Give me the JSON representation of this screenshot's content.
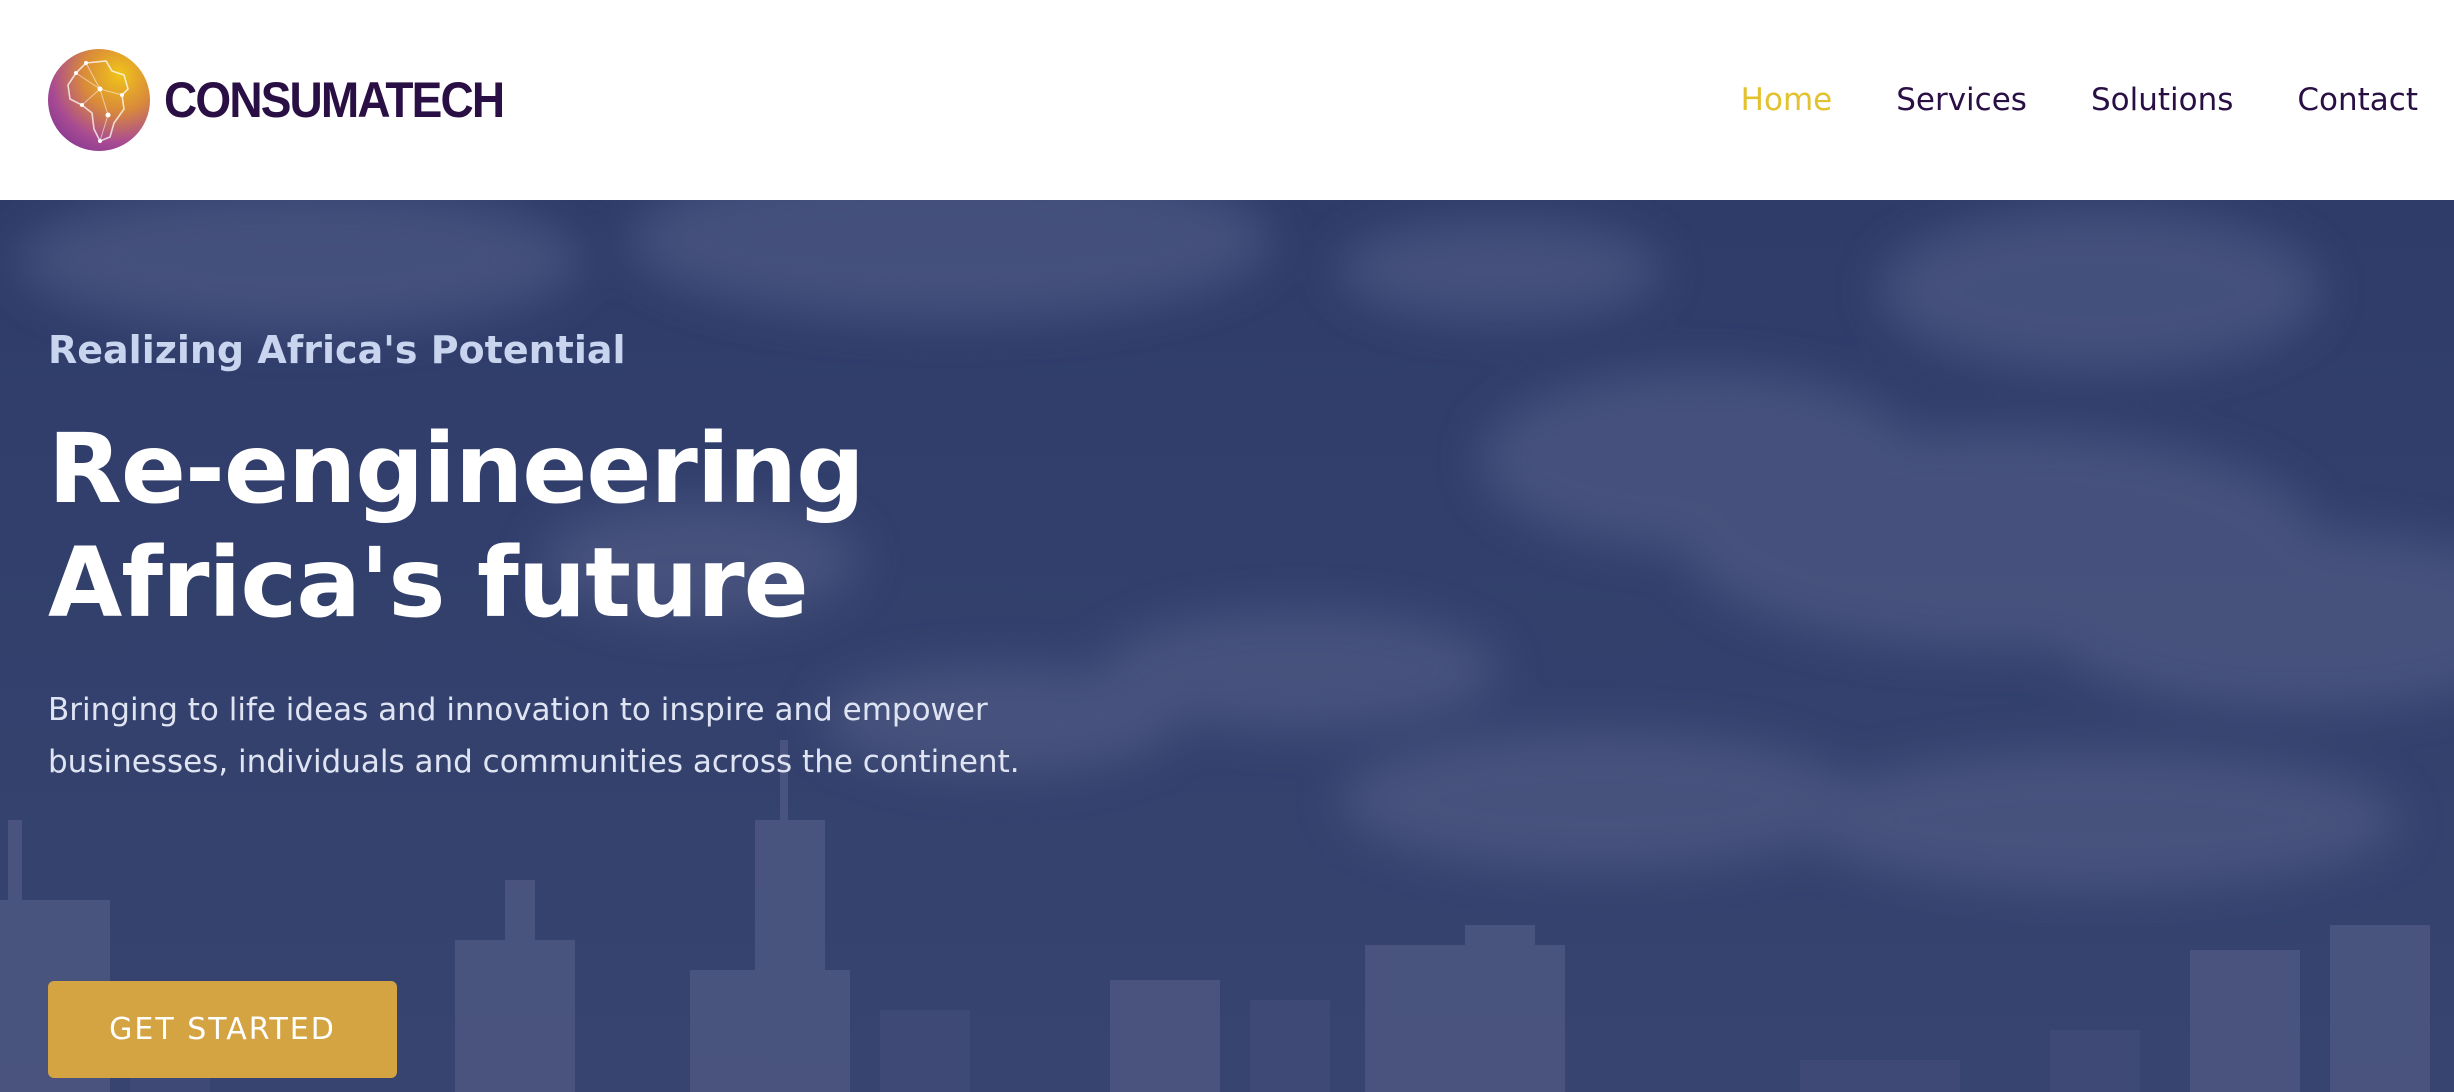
{
  "header": {
    "brand_name": "CONSUMATECH",
    "logo_icon": "africa-map-logo-icon",
    "nav": [
      {
        "label": "Home",
        "active": true
      },
      {
        "label": "Services",
        "active": false
      },
      {
        "label": "Solutions",
        "active": false
      },
      {
        "label": "Contact",
        "active": false
      }
    ]
  },
  "hero": {
    "eyebrow": "Realizing Africa's Potential",
    "headline_line1": "Re-engineering",
    "headline_line2": "Africa's future",
    "subtext_line1": "Bringing to life ideas and innovation to inspire and empower",
    "subtext_line2": "businesses, individuals and communities across the continent.",
    "cta_label": "GET STARTED",
    "background": "city-skyline-with-clouds"
  },
  "colors": {
    "brand_dark": "#2a0f45",
    "nav_active": "#e3c22f",
    "hero_overlay": "#33406e",
    "cta": "#d4a342"
  }
}
